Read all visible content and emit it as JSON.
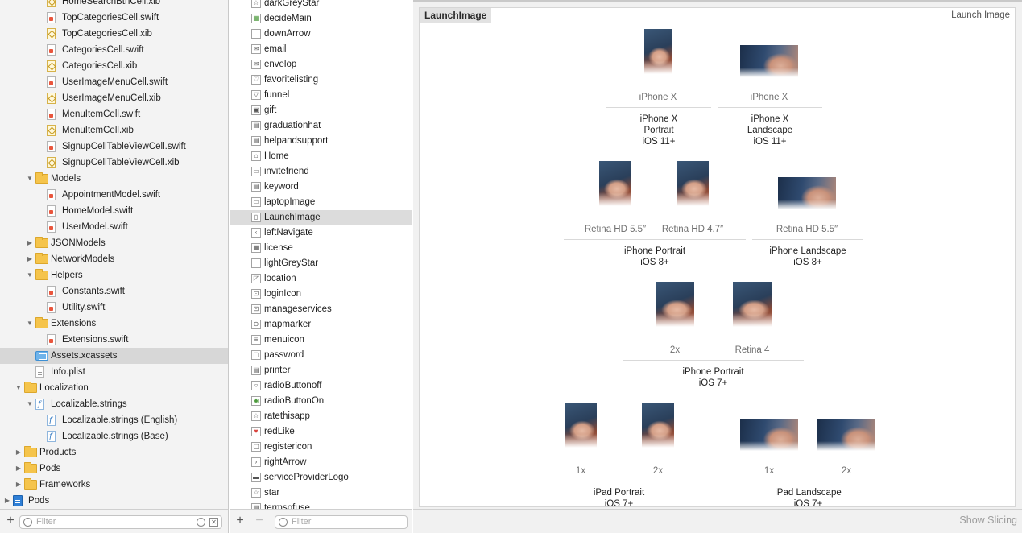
{
  "navigator": {
    "items": [
      {
        "label": "HomeSearchBtnCell.xib",
        "icon": "xib-file-icon",
        "indent": 2,
        "disclosure": ""
      },
      {
        "label": "TopCategoriesCell.swift",
        "icon": "swift-file-icon",
        "indent": 2,
        "disclosure": ""
      },
      {
        "label": "TopCategoriesCell.xib",
        "icon": "xib-file-icon",
        "indent": 2,
        "disclosure": ""
      },
      {
        "label": "CategoriesCell.swift",
        "icon": "swift-file-icon",
        "indent": 2,
        "disclosure": ""
      },
      {
        "label": "CategoriesCell.xib",
        "icon": "xib-file-icon",
        "indent": 2,
        "disclosure": ""
      },
      {
        "label": "UserImageMenuCell.swift",
        "icon": "swift-file-icon",
        "indent": 2,
        "disclosure": ""
      },
      {
        "label": "UserImageMenuCell.xib",
        "icon": "xib-file-icon",
        "indent": 2,
        "disclosure": ""
      },
      {
        "label": "MenuItemCell.swift",
        "icon": "swift-file-icon",
        "indent": 2,
        "disclosure": ""
      },
      {
        "label": "MenuItemCell.xib",
        "icon": "xib-file-icon",
        "indent": 2,
        "disclosure": ""
      },
      {
        "label": "SignupCellTableViewCell.swift",
        "icon": "swift-file-icon",
        "indent": 2,
        "disclosure": ""
      },
      {
        "label": "SignupCellTableViewCell.xib",
        "icon": "xib-file-icon",
        "indent": 2,
        "disclosure": ""
      },
      {
        "label": "Models",
        "icon": "folder-icon",
        "indent": 1,
        "disclosure": "▼"
      },
      {
        "label": "AppointmentModel.swift",
        "icon": "swift-file-icon",
        "indent": 2,
        "disclosure": ""
      },
      {
        "label": "HomeModel.swift",
        "icon": "swift-file-icon",
        "indent": 2,
        "disclosure": ""
      },
      {
        "label": "UserModel.swift",
        "icon": "swift-file-icon",
        "indent": 2,
        "disclosure": ""
      },
      {
        "label": "JSONModels",
        "icon": "folder-icon",
        "indent": 1,
        "disclosure": "▶"
      },
      {
        "label": "NetworkModels",
        "icon": "folder-icon",
        "indent": 1,
        "disclosure": "▶"
      },
      {
        "label": "Helpers",
        "icon": "folder-icon",
        "indent": 1,
        "disclosure": "▼"
      },
      {
        "label": "Constants.swift",
        "icon": "swift-file-icon",
        "indent": 2,
        "disclosure": ""
      },
      {
        "label": "Utility.swift",
        "icon": "swift-file-icon",
        "indent": 2,
        "disclosure": ""
      },
      {
        "label": "Extensions",
        "icon": "folder-icon",
        "indent": 1,
        "disclosure": "▼"
      },
      {
        "label": "Extensions.swift",
        "icon": "swift-file-icon",
        "indent": 2,
        "disclosure": ""
      },
      {
        "label": "Assets.xcassets",
        "icon": "asset-catalog-icon",
        "indent": 1,
        "disclosure": "",
        "selected": true
      },
      {
        "label": "Info.plist",
        "icon": "plist-file-icon",
        "indent": 1,
        "disclosure": ""
      },
      {
        "label": "Localization",
        "icon": "folder-icon",
        "indent": 0,
        "disclosure": "▼"
      },
      {
        "label": "Localizable.strings",
        "icon": "strings-file-icon",
        "indent": 1,
        "disclosure": "▼"
      },
      {
        "label": "Localizable.strings (English)",
        "icon": "strings-file-icon",
        "indent": 2,
        "disclosure": ""
      },
      {
        "label": "Localizable.strings (Base)",
        "icon": "strings-file-icon",
        "indent": 2,
        "disclosure": ""
      },
      {
        "label": "Products",
        "icon": "folder-icon",
        "indent": 0,
        "disclosure": "▶"
      },
      {
        "label": "Pods",
        "icon": "folder-icon",
        "indent": 0,
        "disclosure": "▶"
      },
      {
        "label": "Frameworks",
        "icon": "folder-icon",
        "indent": 0,
        "disclosure": "▶"
      },
      {
        "label": "Pods",
        "icon": "project-icon",
        "indent": -1,
        "disclosure": "▶"
      }
    ],
    "filter_placeholder": "Filter"
  },
  "asset_list": {
    "items": [
      {
        "label": "darkGreyStar",
        "glyph": "☆"
      },
      {
        "label": "decideMain",
        "glyph": "▦"
      },
      {
        "label": "downArrow",
        "glyph": ""
      },
      {
        "label": "email",
        "glyph": "✉"
      },
      {
        "label": "envelop",
        "glyph": "✉"
      },
      {
        "label": "favoritelisting",
        "glyph": "♡"
      },
      {
        "label": "funnel",
        "glyph": "▽"
      },
      {
        "label": "gift",
        "glyph": "▣"
      },
      {
        "label": "graduationhat",
        "glyph": "▤"
      },
      {
        "label": "helpandsupport",
        "glyph": "▤"
      },
      {
        "label": "Home",
        "glyph": "⌂"
      },
      {
        "label": "invitefriend",
        "glyph": "▭"
      },
      {
        "label": "keyword",
        "glyph": "▤"
      },
      {
        "label": "laptopImage",
        "glyph": "▭"
      },
      {
        "label": "LaunchImage",
        "glyph": "▯",
        "selected": true
      },
      {
        "label": "leftNavigate",
        "glyph": "‹"
      },
      {
        "label": "license",
        "glyph": "▦"
      },
      {
        "label": "lightGreyStar",
        "glyph": ""
      },
      {
        "label": "location",
        "glyph": "◸"
      },
      {
        "label": "loginIcon",
        "glyph": "⊡"
      },
      {
        "label": "manageservices",
        "glyph": "⊡"
      },
      {
        "label": "mapmarker",
        "glyph": "⊙"
      },
      {
        "label": "menuicon",
        "glyph": "≡"
      },
      {
        "label": "password",
        "glyph": "▢"
      },
      {
        "label": "printer",
        "glyph": "▤"
      },
      {
        "label": "radioButtonoff",
        "glyph": "○"
      },
      {
        "label": "radioButtonOn",
        "glyph": "◉"
      },
      {
        "label": "ratethisapp",
        "glyph": "☆"
      },
      {
        "label": "redLike",
        "glyph": "♥"
      },
      {
        "label": "registericon",
        "glyph": "▢"
      },
      {
        "label": "rightArrow",
        "glyph": "›"
      },
      {
        "label": "serviceProviderLogo",
        "glyph": "▬"
      },
      {
        "label": "star",
        "glyph": "☆"
      },
      {
        "label": "termsofuse",
        "glyph": "▤"
      }
    ],
    "filter_placeholder": "Filter",
    "add_label": "+",
    "remove_label": "−"
  },
  "editor": {
    "set_name": "LaunchImage",
    "set_type": "Launch Image",
    "show_slicing": "Show Slicing",
    "groups": [
      {
        "lines": [
          "iPhone X",
          "Portrait",
          "iOS 11+"
        ],
        "slots": [
          {
            "label": "iPhone X",
            "orientation": "portrait"
          }
        ]
      },
      {
        "lines": [
          "iPhone X",
          "Landscape",
          "iOS 11+"
        ],
        "slots": [
          {
            "label": "iPhone X",
            "orientation": "landscape"
          }
        ]
      },
      {
        "lines": [
          "iPhone Portrait",
          "iOS 8+"
        ],
        "slots": [
          {
            "label": "Retina HD 5.5″",
            "orientation": "portrait"
          },
          {
            "label": "Retina HD 4.7″",
            "orientation": "portrait"
          }
        ]
      },
      {
        "lines": [
          "iPhone Landscape",
          "iOS 8+"
        ],
        "slots": [
          {
            "label": "Retina HD 5.5″",
            "orientation": "landscape"
          }
        ]
      },
      {
        "lines": [
          "iPhone Portrait",
          "iOS 7+"
        ],
        "slots": [
          {
            "label": "2x",
            "orientation": "portrait"
          },
          {
            "label": "Retina 4",
            "orientation": "portrait"
          }
        ]
      },
      {
        "lines": [
          "iPad Portrait",
          "iOS 7+"
        ],
        "slots": [
          {
            "label": "1x",
            "orientation": "portrait"
          },
          {
            "label": "2x",
            "orientation": "portrait"
          }
        ]
      },
      {
        "lines": [
          "iPad Landscape",
          "iOS 7+"
        ],
        "slots": [
          {
            "label": "1x",
            "orientation": "landscape"
          },
          {
            "label": "2x",
            "orientation": "landscape"
          }
        ]
      }
    ]
  },
  "colors": {
    "navigator_background": "#f3f3f3",
    "selection": "#d7d7d7",
    "folder": "#f5c44b",
    "swift_badge": "#e9553c"
  }
}
